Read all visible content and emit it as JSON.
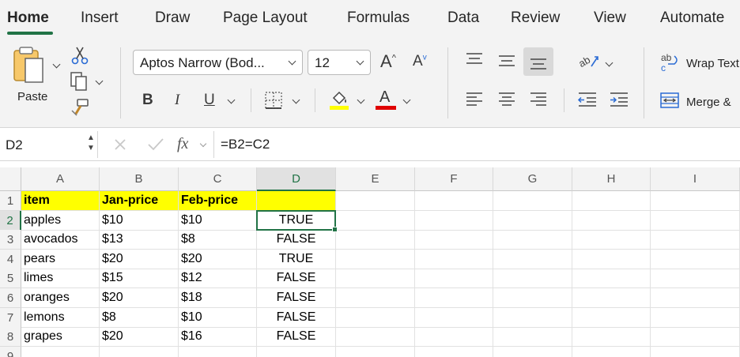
{
  "ribbon_tabs": [
    {
      "label": "Home",
      "active": true
    },
    {
      "label": "Insert"
    },
    {
      "label": "Draw"
    },
    {
      "label": "Page Layout"
    },
    {
      "label": "Formulas"
    },
    {
      "label": "Data"
    },
    {
      "label": "Review"
    },
    {
      "label": "View"
    },
    {
      "label": "Automate"
    }
  ],
  "clipboard": {
    "paste_label": "Paste"
  },
  "font": {
    "name": "Aptos Narrow (Bod...",
    "size": "12",
    "bold": "B",
    "italic": "I",
    "underline": "U",
    "grow": "A",
    "shrink": "A",
    "font_color_letter": "A",
    "fill_color": "#ffff00",
    "font_color": "#e00000"
  },
  "alignment": {
    "wrap_text_label": "Wrap Text",
    "merge_label": "Merge &"
  },
  "formula_bar": {
    "name_box": "D2",
    "fx": "fx",
    "formula": "=B2=C2"
  },
  "sheet": {
    "columns": [
      "A",
      "B",
      "C",
      "D",
      "E",
      "F",
      "G",
      "H",
      "I"
    ],
    "selected_column": "D",
    "selected_row": "2",
    "row_numbers": [
      "1",
      "2",
      "3",
      "4",
      "5",
      "6",
      "7",
      "8",
      "9"
    ],
    "header_row": [
      "item",
      "Jan-price",
      "Feb-price"
    ],
    "rows": [
      [
        "apples",
        "$10",
        "$10",
        "TRUE"
      ],
      [
        "avocados",
        "$13",
        "$8",
        "FALSE"
      ],
      [
        "pears",
        "$20",
        "$20",
        "TRUE"
      ],
      [
        "limes",
        "$15",
        "$12",
        "FALSE"
      ],
      [
        "oranges",
        "$20",
        "$18",
        "FALSE"
      ],
      [
        "lemons",
        "$8",
        "$10",
        "FALSE"
      ],
      [
        "grapes",
        "$20",
        "$16",
        "FALSE"
      ]
    ],
    "accent_color": "#217346",
    "header_fill": "#ffff00"
  }
}
